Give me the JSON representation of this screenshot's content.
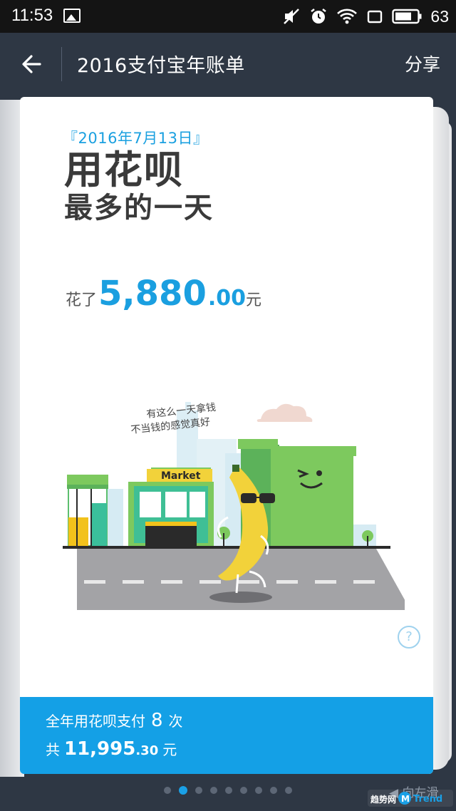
{
  "status_bar": {
    "time": "11:53",
    "battery": "63"
  },
  "app_bar": {
    "title": "2016支付宝年账单",
    "share_label": "分享"
  },
  "card": {
    "date": "『2016年7月13日』",
    "headline_line1": "用花呗",
    "headline_line2": "最多的一天",
    "spent_prefix": "花了",
    "spent_int": "5,880",
    "spent_dec": ".00",
    "spent_unit": "元",
    "bubble_line1": "有这么一天拿钱",
    "bubble_line2": "不当钱的感觉真好",
    "market_sign": "Market",
    "help": "?"
  },
  "summary": {
    "line1_prefix": "全年用花呗支付",
    "count": "8",
    "line1_suffix": "次",
    "line2_prefix": "共",
    "total_int": "11,995",
    "total_dec": ".30",
    "total_unit": "元"
  },
  "pagination": {
    "count": 9,
    "active": 1
  },
  "swipe_hint": "向左滑",
  "watermark": "趋势网 MTrend",
  "colors": {
    "accent": "#1aa0e6",
    "appbar": "#2e3744",
    "green": "#7dc95e"
  }
}
